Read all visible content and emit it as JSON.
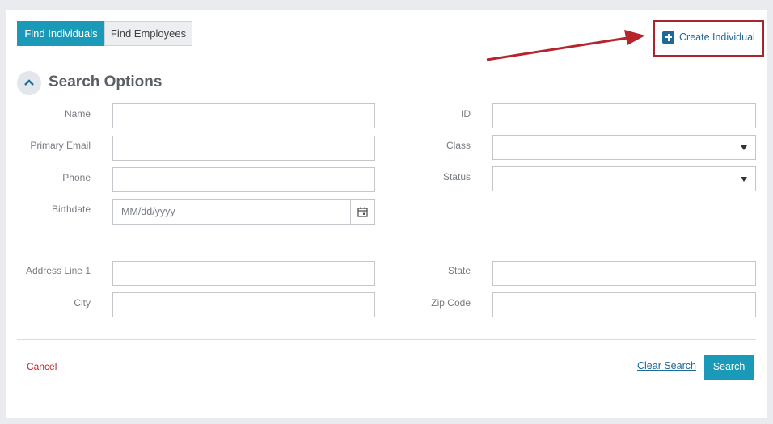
{
  "tabs": [
    {
      "label": "Find Individuals",
      "active": true
    },
    {
      "label": "Find Employees",
      "active": false
    }
  ],
  "create": {
    "label": "Create Individual",
    "icon": "plus-icon"
  },
  "section": {
    "title": "Search Options",
    "toggle_icon": "chevron-up-icon"
  },
  "form": {
    "name": {
      "label": "Name",
      "value": ""
    },
    "primary_email": {
      "label": "Primary Email",
      "value": ""
    },
    "phone": {
      "label": "Phone",
      "value": ""
    },
    "birthdate": {
      "label": "Birthdate",
      "placeholder": "MM/dd/yyyy",
      "icon": "calendar-icon"
    },
    "id": {
      "label": "ID",
      "value": ""
    },
    "class": {
      "label": "Class",
      "selected": ""
    },
    "status": {
      "label": "Status",
      "selected": ""
    },
    "address_line1": {
      "label": "Address Line 1",
      "value": ""
    },
    "city": {
      "label": "City",
      "value": ""
    },
    "state": {
      "label": "State",
      "value": ""
    },
    "zip": {
      "label": "Zip Code",
      "value": ""
    }
  },
  "footer": {
    "cancel": "Cancel",
    "clear": "Clear Search",
    "search": "Search"
  },
  "colors": {
    "primary": "#1a9ab8",
    "link": "#1b6a99",
    "danger": "#c0262e",
    "annotation": "#a8262b"
  }
}
